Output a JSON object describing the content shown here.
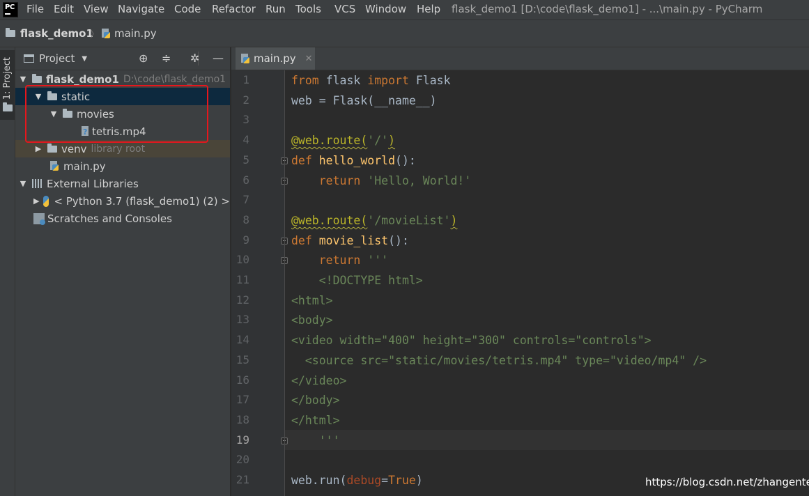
{
  "menubar": {
    "logo": "PC",
    "items": [
      "File",
      "Edit",
      "View",
      "Navigate",
      "Code",
      "Refactor",
      "Run",
      "Tools",
      "VCS",
      "Window",
      "Help"
    ],
    "window_title": "flask_demo1 [D:\\code\\flask_demo1] - ...\\main.py - PyCharm"
  },
  "navbar": {
    "project": "flask_demo1",
    "separator": "〉",
    "file": "main.py"
  },
  "sidestrip": {
    "project_tab": "1: Project"
  },
  "project_panel": {
    "title": "Project",
    "tree": {
      "root": {
        "name": "flask_demo1",
        "path": "D:\\code\\flask_demo1"
      },
      "static": "static",
      "movies": "movies",
      "video_file": "tetris.mp4",
      "venv": {
        "name": "venv",
        "hint": "library root"
      },
      "main_file": "main.py",
      "external_libraries": "External Libraries",
      "python_sdk": "< Python 3.7 (flask_demo1) (2) >",
      "scratches": "Scratches and Consoles"
    }
  },
  "editor": {
    "tab_label": "main.py",
    "line_numbers": [
      "1",
      "2",
      "3",
      "4",
      "5",
      "6",
      "7",
      "8",
      "9",
      "10",
      "11",
      "12",
      "13",
      "14",
      "15",
      "16",
      "17",
      "18",
      "19",
      "20",
      "21"
    ],
    "current_line": "19",
    "code": [
      [
        [
          "kw",
          "from"
        ],
        [
          "t",
          " flask "
        ],
        [
          "kw",
          "import"
        ],
        [
          "t",
          " Flask"
        ]
      ],
      [
        [
          "t",
          "web = Flask(__name__)"
        ]
      ],
      [],
      [
        [
          "deco",
          "@web.route("
        ],
        [
          "str",
          "'/'"
        ],
        [
          "deco",
          ")"
        ]
      ],
      [
        [
          "kw",
          "def "
        ],
        [
          "fn",
          "hello_world"
        ],
        [
          "t",
          "():"
        ]
      ],
      [
        [
          "t",
          "    "
        ],
        [
          "kw",
          "return "
        ],
        [
          "str",
          "'Hello, World!'"
        ]
      ],
      [],
      [
        [
          "deco",
          "@web.route("
        ],
        [
          "str",
          "'/movieList'"
        ],
        [
          "deco",
          ")"
        ]
      ],
      [
        [
          "kw",
          "def "
        ],
        [
          "fn",
          "movie_list"
        ],
        [
          "t",
          "():"
        ]
      ],
      [
        [
          "t",
          "    "
        ],
        [
          "kw",
          "return "
        ],
        [
          "str",
          "'''"
        ]
      ],
      [
        [
          "str",
          "    <!DOCTYPE html>"
        ]
      ],
      [
        [
          "str",
          "<html>"
        ]
      ],
      [
        [
          "str",
          "<body>"
        ]
      ],
      [
        [
          "str",
          "<video width=\"400\" height=\"300\" controls=\"controls\">"
        ]
      ],
      [
        [
          "str",
          "  <source src=\"static/movies/tetris.mp4\" type=\"video/mp4\" />"
        ]
      ],
      [
        [
          "str",
          "</video>"
        ]
      ],
      [
        [
          "str",
          "</body>"
        ]
      ],
      [
        [
          "str",
          "</html>"
        ]
      ],
      [
        [
          "str",
          "    '''"
        ]
      ],
      [],
      [
        [
          "t",
          "web.run("
        ],
        [
          "param",
          "debug"
        ],
        [
          "t",
          "="
        ],
        [
          "kw",
          "True"
        ],
        [
          "t",
          ")"
        ]
      ]
    ]
  },
  "watermark": "https://blog.csdn.net/zhangenter",
  "colors": {
    "highlight_box": "#e5171d",
    "keyword": "#cc7832",
    "string": "#6a8759",
    "decorator": "#bbb529",
    "function": "#ffc66d"
  }
}
